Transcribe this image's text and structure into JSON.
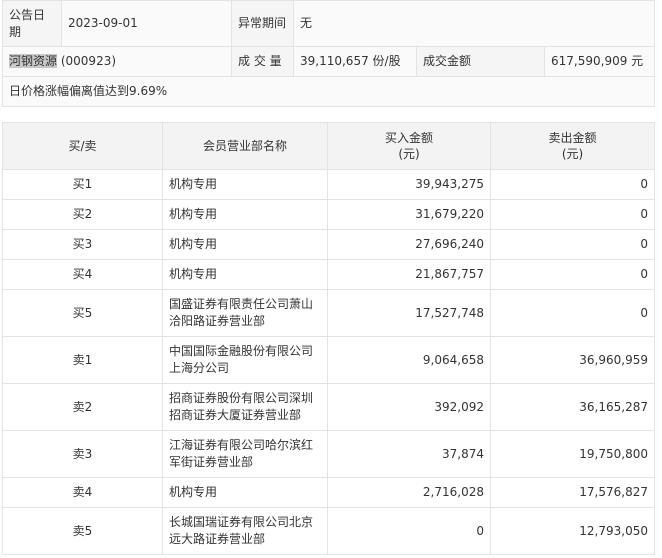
{
  "info": {
    "announce_date_label": "公告日期",
    "announce_date": "2023-09-01",
    "abnormal_period_label": "异常期间",
    "abnormal_period": "无",
    "stock_name": "河钢资源",
    "stock_code": "(000923)",
    "volume_label": "成 交 量",
    "volume": "39,110,657 份/股",
    "amount_label": "成交金额",
    "amount": "617,590,909 元",
    "reason": "日价格涨幅偏离值达到9.69%"
  },
  "table": {
    "headers": {
      "side": "买/卖",
      "member": "会员营业部名称",
      "buy": "买入金额\n(元)",
      "sell": "卖出金额\n(元)"
    },
    "rows": [
      {
        "side": "买1",
        "member": "机构专用",
        "buy": "39,943,275",
        "sell": "0"
      },
      {
        "side": "买2",
        "member": "机构专用",
        "buy": "31,679,220",
        "sell": "0"
      },
      {
        "side": "买3",
        "member": "机构专用",
        "buy": "27,696,240",
        "sell": "0"
      },
      {
        "side": "买4",
        "member": "机构专用",
        "buy": "21,867,757",
        "sell": "0"
      },
      {
        "side": "买5",
        "member": "国盛证券有限责任公司萧山洽阳路证券营业部",
        "buy": "17,527,748",
        "sell": "0"
      },
      {
        "side": "卖1",
        "member": "中国国际金融股份有限公司上海分公司",
        "buy": "9,064,658",
        "sell": "36,960,959"
      },
      {
        "side": "卖2",
        "member": "招商证券股份有限公司深圳招商证券大厦证券营业部",
        "buy": "392,092",
        "sell": "36,165,287"
      },
      {
        "side": "卖3",
        "member": "江海证券有限公司哈尔滨红军街证券营业部",
        "buy": "37,874",
        "sell": "19,750,800"
      },
      {
        "side": "卖4",
        "member": "机构专用",
        "buy": "2,716,028",
        "sell": "17,576,827"
      },
      {
        "side": "卖5",
        "member": "长城国瑞证券有限公司北京远大路证券营业部",
        "buy": "0",
        "sell": "12,793,050"
      }
    ]
  }
}
